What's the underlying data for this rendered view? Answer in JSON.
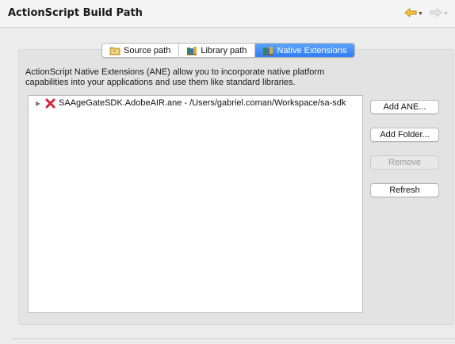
{
  "header": {
    "title": "ActionScript Build Path",
    "back_icon": "arrow-left-icon",
    "forward_icon": "arrow-right-icon"
  },
  "tabs": [
    {
      "label": "Source path",
      "icon": "folder-source-icon",
      "selected": false
    },
    {
      "label": "Library path",
      "icon": "books-icon",
      "selected": false
    },
    {
      "label": "Native Extensions",
      "icon": "books-icon",
      "selected": true
    }
  ],
  "description": "ActionScript Native Extensions (ANE) allow you to incorporate native platform capabilities into your applications and use them like standard libraries.",
  "extensions": [
    {
      "label": "SAAgeGateSDK.AdobeAIR.ane - /Users/gabriel.coman/Workspace/sa-sdk",
      "status_icon": "error-x-icon",
      "expanded": false
    }
  ],
  "buttons": {
    "add_ane": "Add ANE...",
    "add_folder": "Add Folder...",
    "remove": "Remove",
    "refresh": "Refresh"
  },
  "colors": {
    "accent": "#2f7df6",
    "error": "#d0283a"
  }
}
